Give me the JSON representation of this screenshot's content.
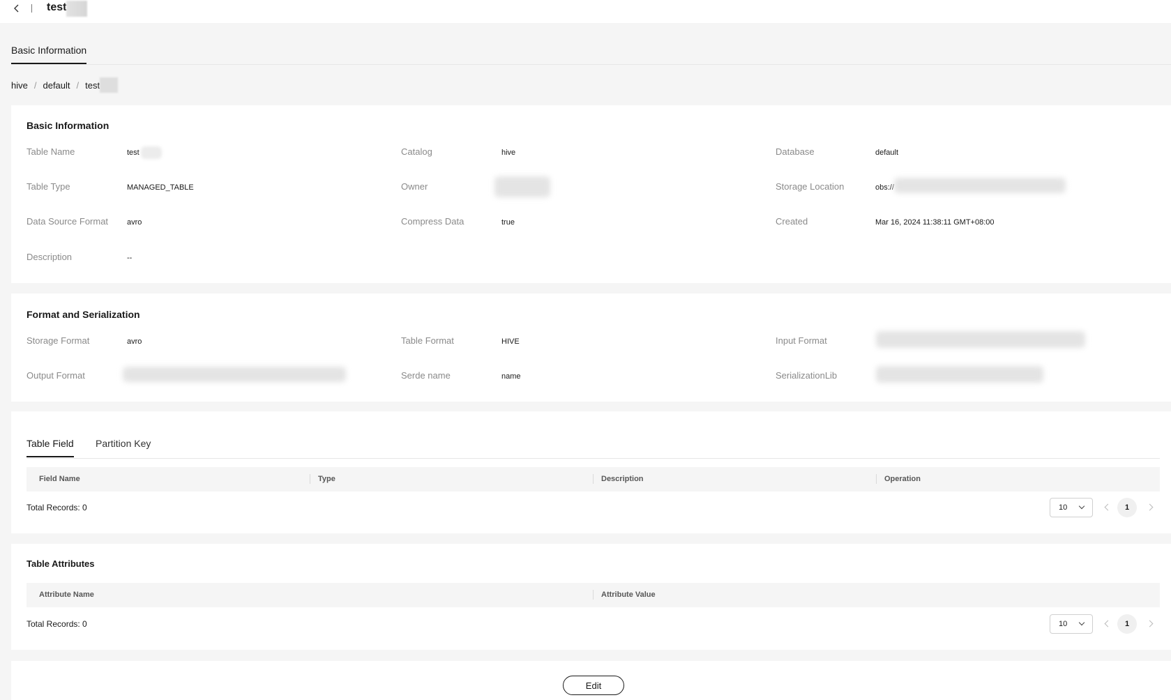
{
  "header": {
    "title": "test"
  },
  "main_tab": "Basic Information",
  "breadcrumb": [
    "hive",
    "default",
    "test"
  ],
  "basic_info": {
    "title": "Basic Information",
    "fields": {
      "table_name": {
        "label": "Table Name",
        "value": "test"
      },
      "catalog": {
        "label": "Catalog",
        "value": "hive"
      },
      "database": {
        "label": "Database",
        "value": "default"
      },
      "table_type": {
        "label": "Table Type",
        "value": "MANAGED_TABLE"
      },
      "owner": {
        "label": "Owner",
        "value": ""
      },
      "storage_location": {
        "label": "Storage Location",
        "value": "obs://"
      },
      "data_source_format": {
        "label": "Data Source Format",
        "value": "avro"
      },
      "compress_data": {
        "label": "Compress Data",
        "value": "true"
      },
      "created": {
        "label": "Created",
        "value": "Mar 16, 2024 11:38:11 GMT+08:00"
      },
      "description": {
        "label": "Description",
        "value": "--"
      }
    }
  },
  "format_serialization": {
    "title": "Format and Serialization",
    "fields": {
      "storage_format": {
        "label": "Storage Format",
        "value": "avro"
      },
      "table_format": {
        "label": "Table Format",
        "value": "HIVE"
      },
      "input_format": {
        "label": "Input Format",
        "value": ""
      },
      "output_format": {
        "label": "Output Format",
        "value": ""
      },
      "serde_name": {
        "label": "Serde name",
        "value": "name"
      },
      "serialization_lib": {
        "label": "SerializationLib",
        "value": ""
      }
    }
  },
  "fields_table": {
    "tabs": [
      "Table Field",
      "Partition Key"
    ],
    "columns": [
      "Field Name",
      "Type",
      "Description",
      "Operation"
    ],
    "total": "Total Records: 0",
    "page_size": "10",
    "page": "1"
  },
  "attributes_table": {
    "title": "Table Attributes",
    "columns": [
      "Attribute Name",
      "Attribute Value"
    ],
    "total": "Total Records: 0",
    "page_size": "10",
    "page": "1"
  },
  "actions": {
    "edit_label": "Edit"
  }
}
